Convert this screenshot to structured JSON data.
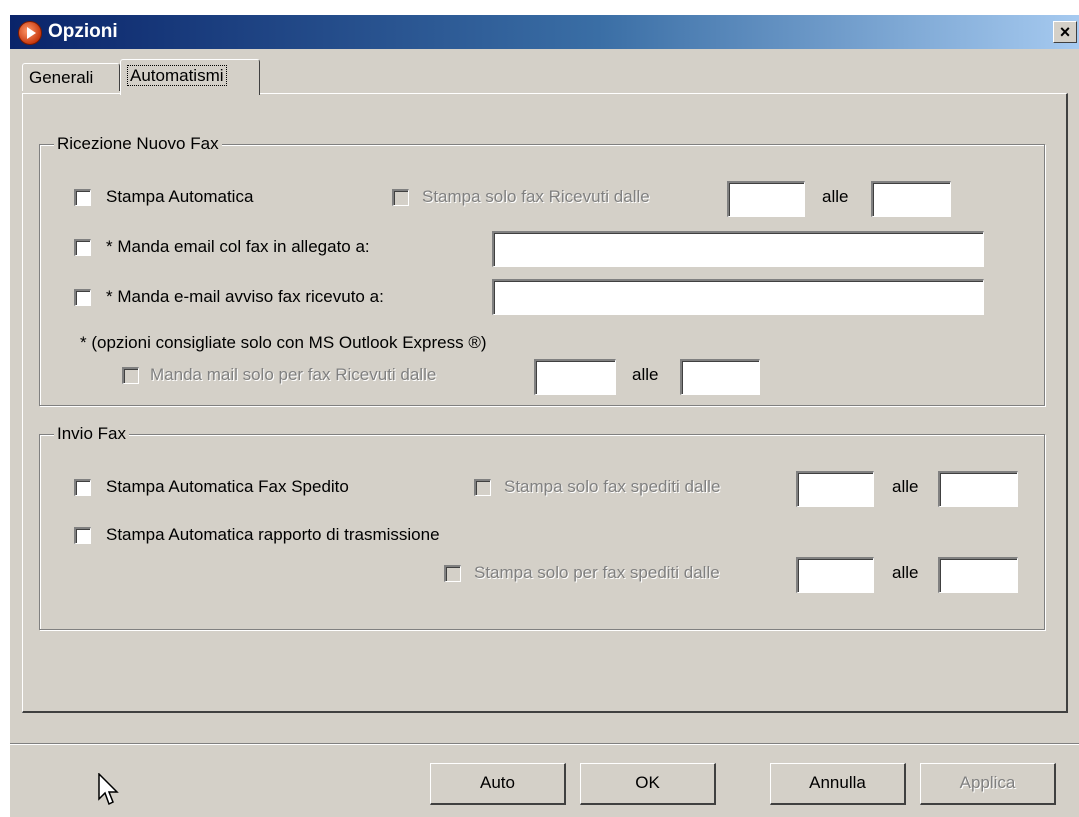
{
  "window": {
    "title": "Opzioni",
    "close_label": "×"
  },
  "tabs": [
    {
      "label": "Generali"
    },
    {
      "label": "Automatismi"
    }
  ],
  "ricezione": {
    "legend": "Ricezione Nuovo Fax",
    "stampa_auto_label": "Stampa Automatica",
    "stampa_solo_label": "Stampa solo fax Ricevuti dalle",
    "alle1": "alle",
    "email_allegato_label": "* Manda email col fax in allegato a:",
    "email_avviso_label": "* Manda e-mail avviso fax ricevuto a:",
    "note": "* (opzioni consigliate solo con MS Outlook Express ®)",
    "mail_solo_label": "Manda mail solo per fax Ricevuti dalle",
    "alle2": "alle"
  },
  "invio": {
    "legend": "Invio Fax",
    "stampa_spedito_label": "Stampa Automatica Fax Spedito",
    "stampa_solo_spediti_label": "Stampa solo fax spediti dalle",
    "alle1": "alle",
    "rapporto_label": "Stampa Automatica rapporto di trasmissione",
    "stampa_solo_per_label": "Stampa solo per fax spediti dalle",
    "alle2": "alle"
  },
  "buttons": {
    "auto": "Auto",
    "ok": "OK",
    "annulla": "Annulla",
    "applica": "Applica"
  }
}
